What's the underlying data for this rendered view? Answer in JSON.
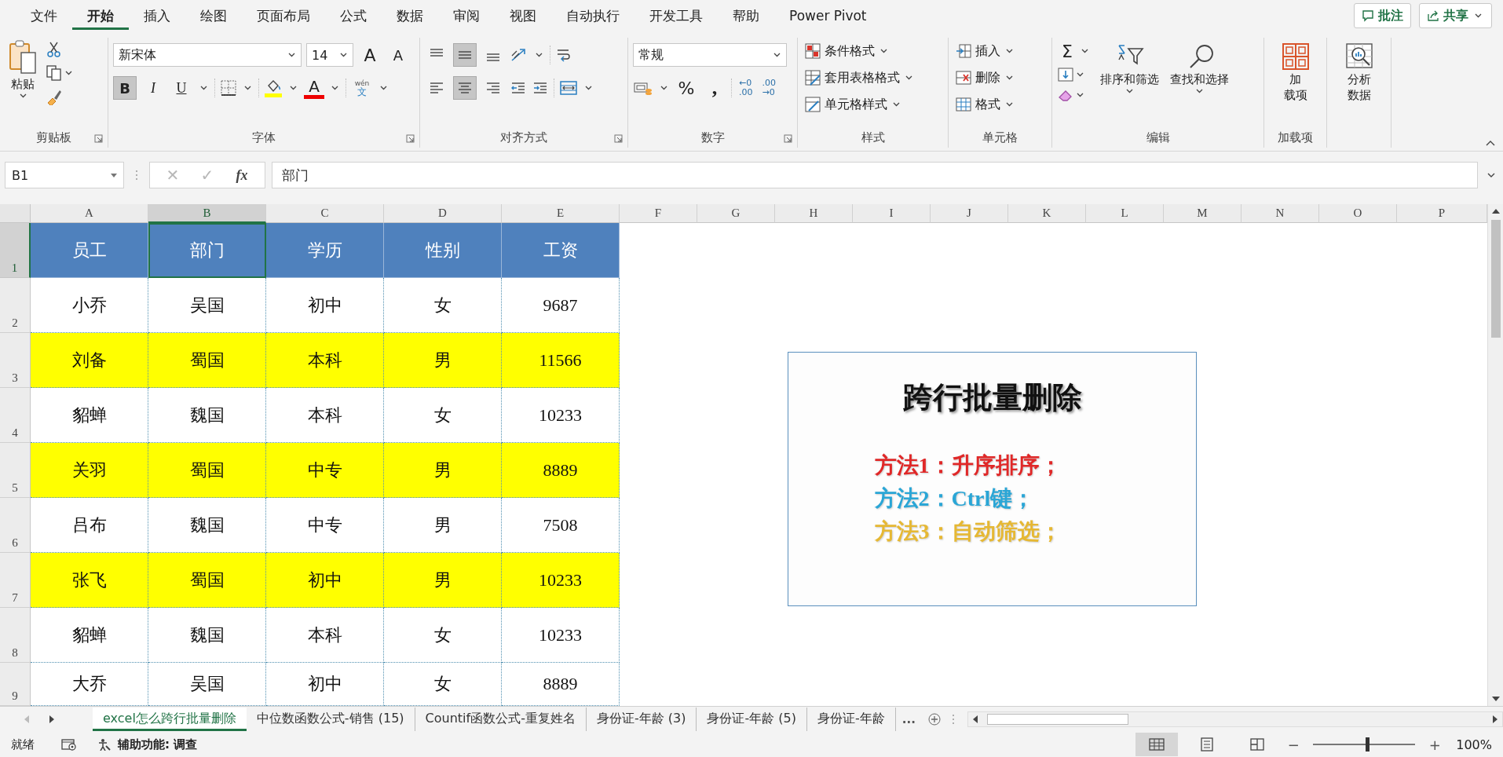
{
  "menu_tabs": [
    {
      "label": "文件",
      "selected": false
    },
    {
      "label": "开始",
      "selected": true
    },
    {
      "label": "插入",
      "selected": false
    },
    {
      "label": "绘图",
      "selected": false
    },
    {
      "label": "页面布局",
      "selected": false
    },
    {
      "label": "公式",
      "selected": false
    },
    {
      "label": "数据",
      "selected": false
    },
    {
      "label": "审阅",
      "selected": false
    },
    {
      "label": "视图",
      "selected": false
    },
    {
      "label": "自动执行",
      "selected": false
    },
    {
      "label": "开发工具",
      "selected": false
    },
    {
      "label": "帮助",
      "selected": false
    },
    {
      "label": "Power Pivot",
      "selected": false
    }
  ],
  "top_buttons": [
    {
      "kind": "comments",
      "label": "批注"
    },
    {
      "kind": "share",
      "label": "共享"
    }
  ],
  "ribbon": {
    "groups": [
      {
        "kind": "clipboard",
        "label": "剪贴板",
        "paste": "粘贴"
      },
      {
        "kind": "font",
        "label": "字体",
        "font_name": "新宋体",
        "font_size": "14",
        "grow": "A",
        "shrink": "A",
        "toggles": [
          {
            "label": "B",
            "selected": true
          },
          {
            "label": "I",
            "selected": false
          },
          {
            "label": "U",
            "selected": false
          }
        ],
        "font_color": "A",
        "phonetic_top": "wén",
        "phonetic_bottom": "文"
      },
      {
        "kind": "alignment",
        "label": "对齐方式",
        "vertical_align": [
          {
            "selected": false
          },
          {
            "selected": true
          },
          {
            "selected": false
          }
        ],
        "horizontal_align": [
          {
            "selected": false
          },
          {
            "selected": true
          },
          {
            "selected": false
          }
        ]
      },
      {
        "kind": "number",
        "label": "数字",
        "format": "常规",
        "percent": "%",
        "comma": ",",
        "increase_decimal": [
          "←0",
          ".00"
        ],
        "decrease_decimal": [
          ".00",
          "→0"
        ]
      },
      {
        "kind": "list",
        "label": "样式",
        "items": [
          "条件格式",
          "套用表格格式",
          "单元格样式"
        ]
      },
      {
        "kind": "list",
        "label": "单元格",
        "items": [
          "插入",
          "删除",
          "格式"
        ]
      },
      {
        "kind": "editing",
        "label": "编辑",
        "autosum": "Σ",
        "large": [
          "排序和筛选",
          "查找和选择"
        ]
      },
      {
        "kind": "large",
        "label": "加载项",
        "lines": [
          "加",
          "载项"
        ]
      },
      {
        "kind": "large",
        "lines": [
          "分析",
          "数据"
        ]
      }
    ]
  },
  "formula_bar": {
    "name_box": "B1",
    "cancel": "✕",
    "enter": "✓",
    "function": "fx",
    "formula": "部门"
  },
  "columns": [
    {
      "label": "A",
      "selected": false
    },
    {
      "label": "B",
      "selected": true
    },
    {
      "label": "C",
      "selected": false
    },
    {
      "label": "D",
      "selected": false
    },
    {
      "label": "E",
      "selected": false
    },
    {
      "label": "F",
      "selected": false
    },
    {
      "label": "G",
      "selected": false
    },
    {
      "label": "H",
      "selected": false
    },
    {
      "label": "I",
      "selected": false
    },
    {
      "label": "J",
      "selected": false
    },
    {
      "label": "K",
      "selected": false
    },
    {
      "label": "L",
      "selected": false
    },
    {
      "label": "M",
      "selected": false
    },
    {
      "label": "N",
      "selected": false
    },
    {
      "label": "O",
      "selected": false
    },
    {
      "label": "P",
      "selected": false
    }
  ],
  "rows": [
    {
      "number": "1",
      "kind": "header",
      "selected": true,
      "highlighted": false,
      "cells": [
        "员工",
        "部门",
        "学历",
        "性别",
        "工资"
      ]
    },
    {
      "number": "2",
      "kind": "data",
      "selected": false,
      "highlighted": false,
      "cells": [
        "小乔",
        "吴国",
        "初中",
        "女",
        "9687"
      ]
    },
    {
      "number": "3",
      "kind": "data",
      "selected": false,
      "highlighted": true,
      "cells": [
        "刘备",
        "蜀国",
        "本科",
        "男",
        "11566"
      ]
    },
    {
      "number": "4",
      "kind": "data",
      "selected": false,
      "highlighted": false,
      "cells": [
        "貂蝉",
        "魏国",
        "本科",
        "女",
        "10233"
      ]
    },
    {
      "number": "5",
      "kind": "data",
      "selected": false,
      "highlighted": true,
      "cells": [
        "关羽",
        "蜀国",
        "中专",
        "男",
        "8889"
      ]
    },
    {
      "number": "6",
      "kind": "data",
      "selected": false,
      "highlighted": false,
      "cells": [
        "吕布",
        "魏国",
        "中专",
        "男",
        "7508"
      ]
    },
    {
      "number": "7",
      "kind": "data",
      "selected": false,
      "highlighted": true,
      "cells": [
        "张飞",
        "蜀国",
        "初中",
        "男",
        "10233"
      ]
    },
    {
      "number": "8",
      "kind": "data",
      "selected": false,
      "highlighted": false,
      "cells": [
        "貂蝉",
        "魏国",
        "本科",
        "女",
        "10233"
      ]
    },
    {
      "number": "9",
      "kind": "data",
      "selected": false,
      "highlighted": false,
      "cells": [
        "大乔",
        "吴国",
        "初中",
        "女",
        "8889"
      ]
    }
  ],
  "textbox": {
    "title": "跨行批量删除",
    "lines": [
      {
        "text": "方法1：升序排序；",
        "color": "#e02828"
      },
      {
        "text": "方法2：Ctrl键；",
        "color": "#2aa6d6"
      },
      {
        "text": "方法3：自动筛选；",
        "color": "#e6b833"
      }
    ]
  },
  "sheet_tabs": [
    {
      "label": "excel怎么跨行批量删除",
      "selected": true
    },
    {
      "label": "中位数函数公式-销售 (15)",
      "selected": false
    },
    {
      "label": "Countif函数公式-重复姓名",
      "selected": false
    },
    {
      "label": "身份证-年龄 (3)",
      "selected": false
    },
    {
      "label": "身份证-年龄 (5)",
      "selected": false
    },
    {
      "label": "身份证-年龄",
      "selected": false
    }
  ],
  "more_sheets": "...",
  "status_bar": {
    "mode": "就绪",
    "accessibility": "辅助功能: 调查",
    "views": [
      {
        "selected": true
      },
      {
        "selected": false
      },
      {
        "selected": false
      }
    ],
    "zoom_out": "−",
    "zoom_in": "+",
    "zoom": {
      "level": 0.53
    },
    "zoom_reading": "100%"
  }
}
